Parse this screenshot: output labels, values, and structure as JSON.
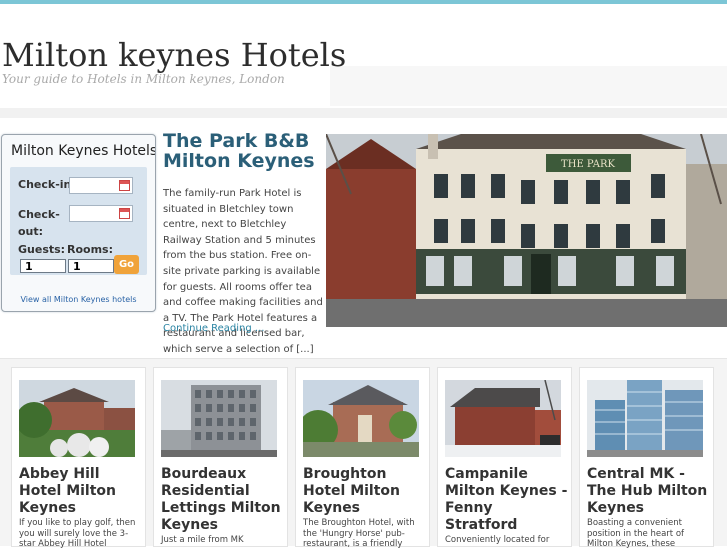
{
  "site": {
    "title": "Milton keynes Hotels",
    "tagline": "Your guide to Hotels in Milton keynes, London"
  },
  "widget": {
    "heading": "Milton Keynes Hotels",
    "checkin_label": "Check-in:",
    "checkout_label": "Check-out:",
    "guests_label": "Guests:",
    "rooms_label": "Rooms:",
    "guests_value": "1",
    "rooms_value": "1",
    "go_label": "Go",
    "view_all": "View all Milton Keynes hotels"
  },
  "featured": {
    "title": "The Park B&B Milton Keynes",
    "description": "The family-run Park Hotel is situated in Bletchley town centre, next to Bletchley Railway Station and 5 minutes from the bus station. Free on-site private parking is available for guests. All rooms offer tea and coffee making facilities and a TV. The Park Hotel features a restaurant and licensed bar, which serve a selection of [...]",
    "more": "Continue Reading ...",
    "sign_text": "THE PARK"
  },
  "cards": [
    {
      "title": "Abbey Hill Hotel Milton Keynes",
      "desc": "If you like to play golf, then you will surely love the 3-star Abbey Hill Hotel"
    },
    {
      "title": "Bourdeaux Residential Lettings Milton Keynes",
      "desc": "Just a mile from MK"
    },
    {
      "title": "Broughton Hotel Milton Keynes",
      "desc": "The Broughton Hotel, with the 'Hungry Horse' pub-restaurant, is a friendly"
    },
    {
      "title": "Campanile Milton Keynes - Fenny Stratford",
      "desc": "Conveniently located for"
    },
    {
      "title": "Central MK - The Hub Milton Keynes",
      "desc": "Boasting a convenient position in the heart of Milton Keynes, these"
    }
  ]
}
